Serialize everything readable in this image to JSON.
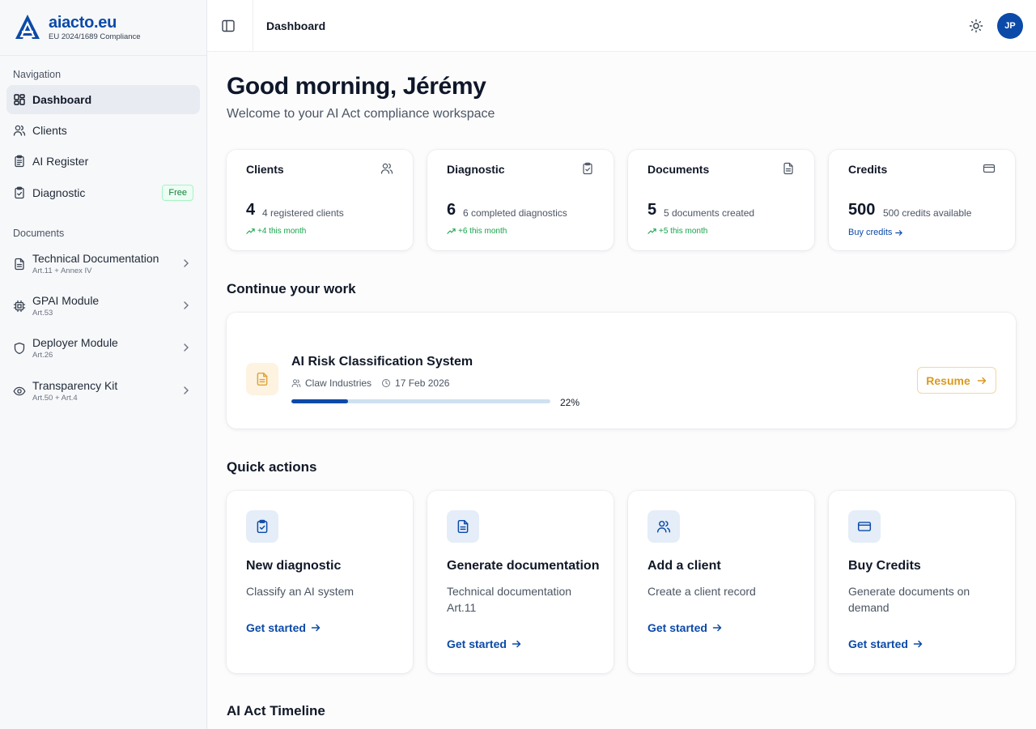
{
  "brand": {
    "name": "aiacto.eu",
    "subtitle": "EU 2024/1689 Compliance"
  },
  "sidebar": {
    "navigation_title": "Navigation",
    "items": [
      {
        "label": "Dashboard",
        "icon": "grid-icon",
        "active": true
      },
      {
        "label": "Clients",
        "icon": "users-icon"
      },
      {
        "label": "AI Register",
        "icon": "clipboard-list-icon"
      },
      {
        "label": "Diagnostic",
        "icon": "clipboard-check-icon",
        "badge": "Free"
      }
    ],
    "documents_title": "Documents",
    "documents": [
      {
        "title": "Technical Documentation",
        "sub": "Art.11 + Annex IV",
        "icon": "file-text-icon"
      },
      {
        "title": "GPAI Module",
        "sub": "Art.53",
        "icon": "cpu-icon"
      },
      {
        "title": "Deployer Module",
        "sub": "Art.26",
        "icon": "shield-icon"
      },
      {
        "title": "Transparency Kit",
        "sub": "Art.50 + Art.4",
        "icon": "eye-icon"
      }
    ]
  },
  "header": {
    "title": "Dashboard",
    "avatar_initials": "JP"
  },
  "main": {
    "greeting": "Good morning, Jérémy",
    "welcome": "Welcome to your AI Act compliance workspace",
    "stats": [
      {
        "label": "Clients",
        "value": "4",
        "desc": "4 registered clients",
        "trend": "+4 this month",
        "icon": "users-icon"
      },
      {
        "label": "Diagnostic",
        "value": "6",
        "desc": "6 completed diagnostics",
        "trend": "+6 this month",
        "icon": "clipboard-check-icon"
      },
      {
        "label": "Documents",
        "value": "5",
        "desc": "5 documents created",
        "trend": "+5 this month",
        "icon": "file-text-icon"
      },
      {
        "label": "Credits",
        "value": "500",
        "desc": "500 credits available",
        "link": "Buy credits",
        "icon": "credit-card-icon"
      }
    ],
    "continue_title": "Continue your work",
    "work": {
      "title": "AI Risk Classification System",
      "client": "Claw Industries",
      "date": "17 Feb 2026",
      "progress": 22,
      "progress_label": "22%",
      "resume_label": "Resume"
    },
    "quick_actions_title": "Quick actions",
    "quick_actions": [
      {
        "title": "New diagnostic",
        "desc": "Classify an AI system",
        "link": "Get started",
        "icon": "clipboard-check-icon"
      },
      {
        "title": "Generate documentation",
        "desc": "Technical documentation Art.11",
        "link": "Get started",
        "icon": "file-text-icon"
      },
      {
        "title": "Add a client",
        "desc": "Create a client record",
        "link": "Get started",
        "icon": "users-icon"
      },
      {
        "title": "Buy Credits",
        "desc": "Generate documents on demand",
        "link": "Get started",
        "icon": "credit-card-icon"
      }
    ],
    "timeline_title": "AI Act Timeline"
  },
  "colors": {
    "brand": "#0b4aa8",
    "success": "#16a34a",
    "accent_amber": "#d99a1e"
  }
}
